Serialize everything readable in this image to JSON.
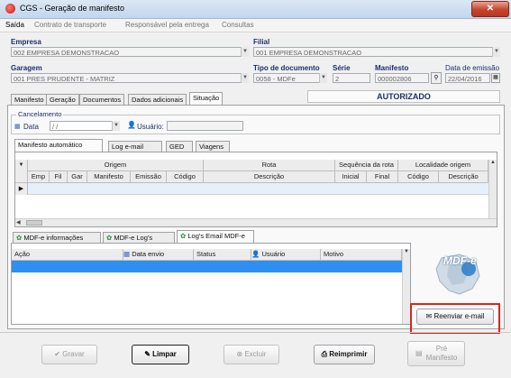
{
  "window": {
    "title": "CGS - Geração de manifesto",
    "close": "✕"
  },
  "menu": [
    "Saída",
    "Contrato de transporte",
    "Responsável pela entrega",
    "Consultas"
  ],
  "form": {
    "empresa_label": "Empresa",
    "empresa_value": "002 EMPRESA DEMONSTRACAO",
    "filial_label": "Filial",
    "filial_value": "001 EMPRESA DEMONSTRACAO",
    "garagem_label": "Garagem",
    "garagem_value": "001 PRES PRUDENTE - MATRIZ",
    "tipo_label": "Tipo de documento",
    "tipo_value": "0058 - MDFe",
    "serie_label": "Série",
    "serie_value": "2",
    "manifesto_label": "Manifesto",
    "manifesto_value": "000002806",
    "emissao_label": "Data de emissão",
    "emissao_value": "22/04/2016",
    "status": "AUTORIZADO"
  },
  "main_tabs": [
    "Manifesto",
    "Geração",
    "Documentos",
    "Dados adicionais",
    "Situação"
  ],
  "cancel": {
    "group_label": "Cancelamento",
    "data_label": "Data",
    "data_value": "  /  /",
    "usuario_label": "Usuário:"
  },
  "sub_tabs": [
    "Manifesto automático",
    "Log e-mail",
    "GED",
    "Viagens"
  ],
  "grid1": {
    "groups": [
      "Origem",
      "Rota",
      "Sequência da rota",
      "Localidade origem"
    ],
    "columns": [
      "Emp",
      "Fil",
      "Gar",
      "Manifesto",
      "Emissão",
      "Código",
      "Descrição",
      "Inicial",
      "Final",
      "Código",
      "Descrição"
    ]
  },
  "lower_tabs": [
    "MDF-e informações",
    "MDF-e Log's",
    "Log's Email MDF-e"
  ],
  "grid2": {
    "columns": [
      "Ação",
      "Data envio",
      "Status",
      "Usuário",
      "Motivo"
    ]
  },
  "logo_text": "MDF-e",
  "reenviar_label": "Reenviar e-mail",
  "buttons": {
    "gravar": "Gravar",
    "limpar": "Limpar",
    "excluir": "Excluir",
    "reimprimir": "Reimprimir",
    "pre_manifesto_1": "Pré",
    "pre_manifesto_2": "Manifesto"
  },
  "colors": {
    "accent_blue": "#1c2f6a",
    "highlight_red": "#d9261c",
    "selected_row": "#2e8ff0"
  }
}
